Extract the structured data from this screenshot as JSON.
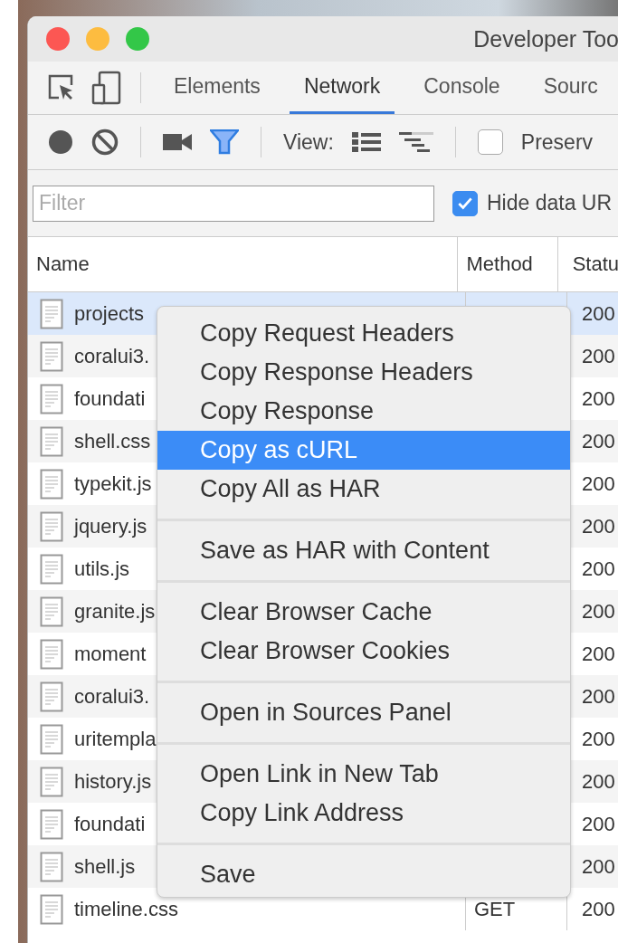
{
  "window": {
    "title": "Developer Too"
  },
  "tabs": [
    {
      "label": "Elements",
      "selected": false
    },
    {
      "label": "Network",
      "selected": true
    },
    {
      "label": "Console",
      "selected": false
    },
    {
      "label": "Sourc",
      "selected": false
    }
  ],
  "toolbar": {
    "filter_active": true,
    "view_label": "View:",
    "preserve": {
      "label": "Preserv",
      "checked": false
    }
  },
  "filter": {
    "placeholder": "Filter",
    "hide_data": {
      "label": "Hide data UR",
      "checked": true
    }
  },
  "table": {
    "columns": [
      "Name",
      "Method",
      "Statu"
    ],
    "rows": [
      {
        "name": "projects",
        "status": "200",
        "selected": true
      },
      {
        "name": "coralui3.",
        "status": "200",
        "selected": false
      },
      {
        "name": "foundati",
        "status": "200",
        "selected": false
      },
      {
        "name": "shell.css",
        "status": "200",
        "selected": false
      },
      {
        "name": "typekit.js",
        "status": "200",
        "selected": false
      },
      {
        "name": "jquery.js",
        "status": "200",
        "selected": false
      },
      {
        "name": "utils.js",
        "status": "200",
        "selected": false
      },
      {
        "name": "granite.js",
        "status": "200",
        "selected": false
      },
      {
        "name": "moment",
        "status": "200",
        "selected": false
      },
      {
        "name": "coralui3.",
        "status": "200",
        "selected": false
      },
      {
        "name": "uritempla",
        "status": "200",
        "selected": false
      },
      {
        "name": "history.js",
        "status": "200",
        "selected": false
      },
      {
        "name": "foundati",
        "status": "200",
        "selected": false
      },
      {
        "name": "shell.js",
        "status": "200",
        "selected": false
      },
      {
        "name": "timeline.css",
        "method": "GET",
        "status": "200",
        "selected": false
      }
    ]
  },
  "context_menu": {
    "groups": [
      [
        {
          "label": "Copy Request Headers",
          "selected": false
        },
        {
          "label": "Copy Response Headers",
          "selected": false
        },
        {
          "label": "Copy Response",
          "selected": false
        },
        {
          "label": "Copy as cURL",
          "selected": true
        },
        {
          "label": "Copy All as HAR",
          "selected": false
        }
      ],
      [
        {
          "label": "Save as HAR with Content",
          "selected": false
        }
      ],
      [
        {
          "label": "Clear Browser Cache",
          "selected": false
        },
        {
          "label": "Clear Browser Cookies",
          "selected": false
        }
      ],
      [
        {
          "label": "Open in Sources Panel",
          "selected": false
        }
      ],
      [
        {
          "label": "Open Link in New Tab",
          "selected": false
        },
        {
          "label": "Copy Link Address",
          "selected": false
        }
      ],
      [
        {
          "label": "Save",
          "selected": false
        }
      ]
    ]
  }
}
